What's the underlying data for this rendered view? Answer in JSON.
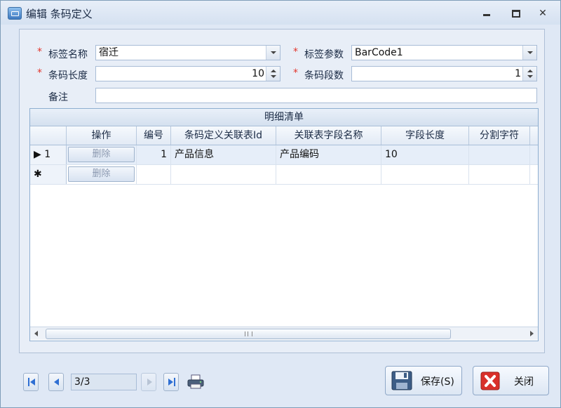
{
  "window": {
    "title": "编辑 条码定义",
    "minimize_icon": "minimize-icon",
    "maximize_icon": "maximize-icon",
    "close_symbol": "✕"
  },
  "form": {
    "required_mark": "*",
    "label_name": {
      "label": "标签名称",
      "value": "宿迁"
    },
    "label_param": {
      "label": "标签参数",
      "value": "BarCode1"
    },
    "code_length": {
      "label": "条码长度",
      "value": "10"
    },
    "segment_count": {
      "label": "条码段数",
      "value": "1"
    },
    "remark": {
      "label": "备注",
      "value": ""
    }
  },
  "grid": {
    "caption": "明细清单",
    "columns": [
      "操作",
      "编号",
      "条码定义关联表Id",
      "关联表字段名称",
      "字段长度",
      "分割字符"
    ],
    "rows": [
      {
        "indicator": "▶ 1",
        "action": "删除",
        "no": "1",
        "table_id": "产品信息",
        "field_name": "产品编码",
        "length": "10",
        "separator": ""
      },
      {
        "indicator": "✱",
        "action": "删除",
        "no": "",
        "table_id": "",
        "field_name": "",
        "length": "",
        "separator": ""
      }
    ]
  },
  "navigator": {
    "position": "3/3"
  },
  "buttons": {
    "save": "保存(S)",
    "close": "关闭"
  },
  "colors": {
    "required": "#e3352b",
    "nav_arrow": "#2f6fd3",
    "close_red": "#d9302a"
  }
}
